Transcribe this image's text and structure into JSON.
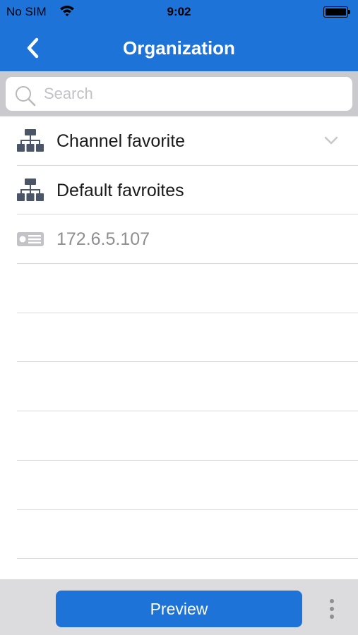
{
  "status_bar": {
    "carrier": "No SIM",
    "time": "9:02",
    "icons": {
      "wifi": "wifi-icon",
      "battery": "battery-icon"
    }
  },
  "nav": {
    "title": "Organization",
    "back_icon": "chevron-left-icon"
  },
  "search": {
    "placeholder": "Search",
    "value": "",
    "icon": "search-icon"
  },
  "list": {
    "items": [
      {
        "label": "Channel favorite",
        "icon": "org-tree-icon",
        "expandable": true,
        "expand_icon": "chevron-down-icon"
      },
      {
        "label": "Default favroites",
        "icon": "org-tree-icon",
        "expandable": false
      },
      {
        "label": "172.6.5.107",
        "icon": "device-icon",
        "muted": true
      }
    ],
    "empty_rows": 6
  },
  "bottom_bar": {
    "preview_label": "Preview",
    "more_icon": "more-vertical-icon"
  },
  "colors": {
    "accent": "#1e73d8",
    "search_bg": "#c9c9ce",
    "bottom_bg": "#dcdcdf",
    "divider": "#d9d9dc",
    "muted_text": "#8e8e93",
    "icon_dark": "#4a5568"
  }
}
